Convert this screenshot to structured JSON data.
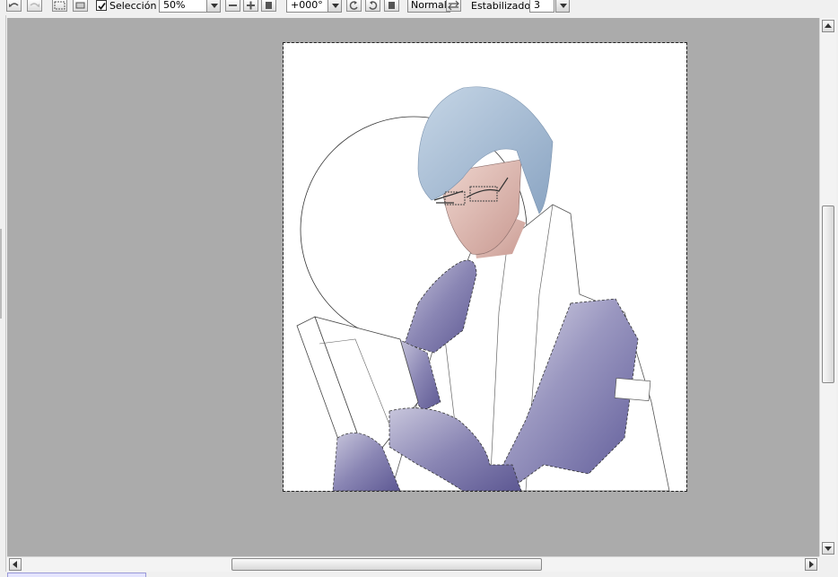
{
  "toolbar": {
    "selection_checked": true,
    "selection_label": "Selección",
    "zoom_value": "50%",
    "rotation_value": "+000°",
    "blend_mode": "Normal",
    "stabilizer_label": "Estabilizador",
    "stabilizer_value": "3",
    "icons": [
      "undo-icon",
      "redo-icon",
      "select-layer-icon",
      "transform-icon",
      "zoom-out-icon",
      "zoom-in-icon",
      "zoom-reset-icon",
      "rotate-left-icon",
      "rotate-right-icon",
      "rotate-reset-icon",
      "flip-icon"
    ]
  },
  "canvas": {
    "artwork": "character-illustration",
    "background_color": "#ffffff",
    "workspace_color": "#ababab"
  },
  "scrollbars": {
    "vertical_position": 0.38,
    "horizontal_position": 0.28
  }
}
